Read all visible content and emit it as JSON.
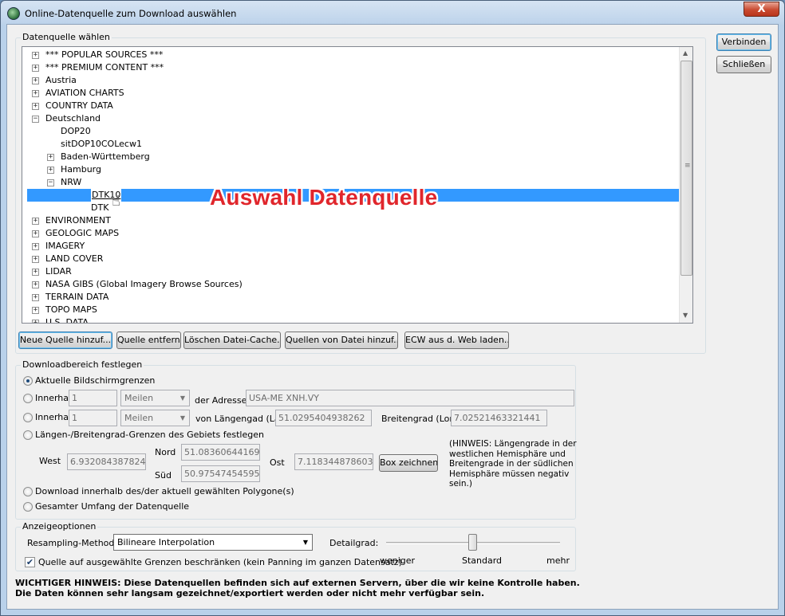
{
  "window": {
    "title": "Online-Datenquelle zum Download auswählen",
    "close_symbol": "X",
    "app_icon": "globe-icon"
  },
  "side_buttons": {
    "connect": "Verbinden",
    "close": "Schließen"
  },
  "source_group": {
    "label": "Datenquelle wählen",
    "tree": [
      {
        "text": "*** POPULAR SOURCES ***",
        "expander": "+",
        "level": 0
      },
      {
        "text": "*** PREMIUM CONTENT ***",
        "expander": "+",
        "level": 0
      },
      {
        "text": "Austria",
        "expander": "+",
        "level": 0
      },
      {
        "text": "AVIATION CHARTS",
        "expander": "+",
        "level": 0
      },
      {
        "text": "COUNTRY DATA",
        "expander": "+",
        "level": 0
      },
      {
        "text": "Deutschland",
        "expander": "−",
        "level": 0
      },
      {
        "text": "DOP20",
        "expander": "",
        "level": 1
      },
      {
        "text": "sitDOP10COLecw1",
        "expander": "",
        "level": 1
      },
      {
        "text": "Baden-Württemberg",
        "expander": "+",
        "level": 1
      },
      {
        "text": "Hamburg",
        "expander": "+",
        "level": 1
      },
      {
        "text": "NRW",
        "expander": "−",
        "level": 1
      },
      {
        "text": "DTK10",
        "expander": "",
        "level": 2,
        "selected": true
      },
      {
        "text": "DTK",
        "expander": "",
        "level": 2
      },
      {
        "text": "ENVIRONMENT",
        "expander": "+",
        "level": 0
      },
      {
        "text": "GEOLOGIC MAPS",
        "expander": "+",
        "level": 0
      },
      {
        "text": "IMAGERY",
        "expander": "+",
        "level": 0
      },
      {
        "text": "LAND COVER",
        "expander": "+",
        "level": 0
      },
      {
        "text": "LIDAR",
        "expander": "+",
        "level": 0
      },
      {
        "text": "NASA GIBS (Global Imagery Browse Sources)",
        "expander": "+",
        "level": 0
      },
      {
        "text": "TERRAIN DATA",
        "expander": "+",
        "level": 0
      },
      {
        "text": "TOPO MAPS",
        "expander": "+",
        "level": 0
      },
      {
        "text": "U.S. DATA",
        "expander": "+",
        "level": 0
      }
    ],
    "overlay_annotation": "Auswahl Datenquelle",
    "buttons": {
      "add_new": "Neue Quelle hinzuf...",
      "remove": "Quelle entfernen",
      "clear_cache": "Löschen Datei-Cache...",
      "add_from_file": "Quellen von Datei hinzuf...",
      "load_ecw": "ECW aus d. Web laden..."
    }
  },
  "download_group": {
    "label": "Downloadbereich festlegen",
    "current_screen": "Aktuelle Bildschirmgrenzen",
    "within1": {
      "label": "Innerhalb",
      "value": "1",
      "unit": "Meilen",
      "suffix": "der Adresse",
      "address": "USA-ME XNH.VY"
    },
    "within2": {
      "label": "Innerhalb",
      "value": "1",
      "unit": "Meilen",
      "lon_label": "von Längengad (Lat)",
      "lon_value": "51.0295404938262",
      "lat_label": "Breitengrad (Lon)",
      "lat_value": "7.02521463321441"
    },
    "bounds": {
      "label": "Längen-/Breitengrad-Grenzen des Gebiets festlegen",
      "west_label": "West",
      "west": "6.9320843878249",
      "north_label": "Nord",
      "north": "51.0836064416973",
      "south_label": "Süd",
      "south": "50.9754745459551",
      "east_label": "Ost",
      "east": "7.11834487860392",
      "draw_button": "Box zeichnen...",
      "hint": "(HINWEIS: Längengrade in der westlichen Hemisphäre und Breitengrade in der südlichen Hemisphäre müssen negativ sein.)"
    },
    "polygons": "Download innerhalb des/der aktuell gewählten Polygone(s)",
    "full_extent": "Gesamter Umfang der Datenquelle"
  },
  "display_group": {
    "label": "Anzeigeoptionen",
    "resampling_label": "Resampling-Methode:",
    "resampling_value": "Bilineare Interpolation",
    "detail_label": "Detailgrad:",
    "detail_level": 0.5,
    "slider_min": "weniger",
    "slider_mid": "Standard",
    "slider_max": "mehr",
    "restrict_checkbox": "Quelle auf ausgewählte Grenzen beschränken (kein Panning im ganzen Datensatz)",
    "restrict_checked": true
  },
  "warning": "WICHTIGER HINWEIS: Diese Datenquellen befinden sich auf externen Servern, über die wir keine Kontrolle haben. Die Daten können sehr langsam gezeichnet/exportiert werden oder nicht mehr verfügbar sein."
}
